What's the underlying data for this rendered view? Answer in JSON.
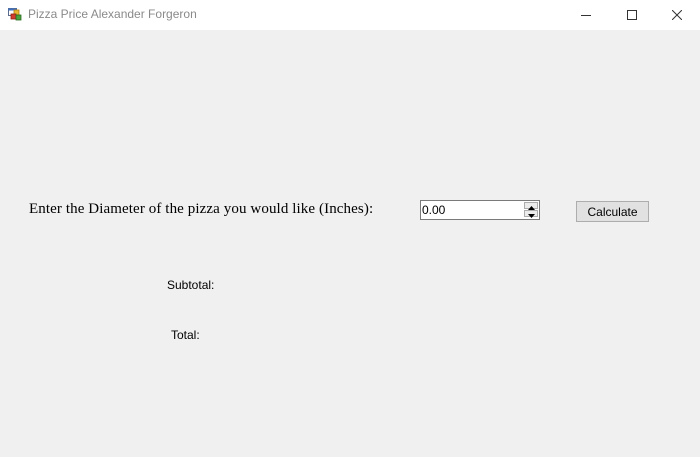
{
  "window": {
    "title": "Pizza Price Alexander Forgeron",
    "icon": "app-form-icon",
    "controls": [
      "minimize-icon",
      "maximize-icon",
      "close-icon"
    ]
  },
  "form": {
    "prompt_label": "Enter the Diameter of the pizza you would like (Inches):",
    "diameter_value": "0.00",
    "calculate_label": "Calculate",
    "subtotal_label": "Subtotal:",
    "total_label": "Total:"
  },
  "colors": {
    "background": "#f0f0f0",
    "titlebar": "#ffffff",
    "button_face": "#e1e1e1",
    "button_border": "#adadad"
  }
}
